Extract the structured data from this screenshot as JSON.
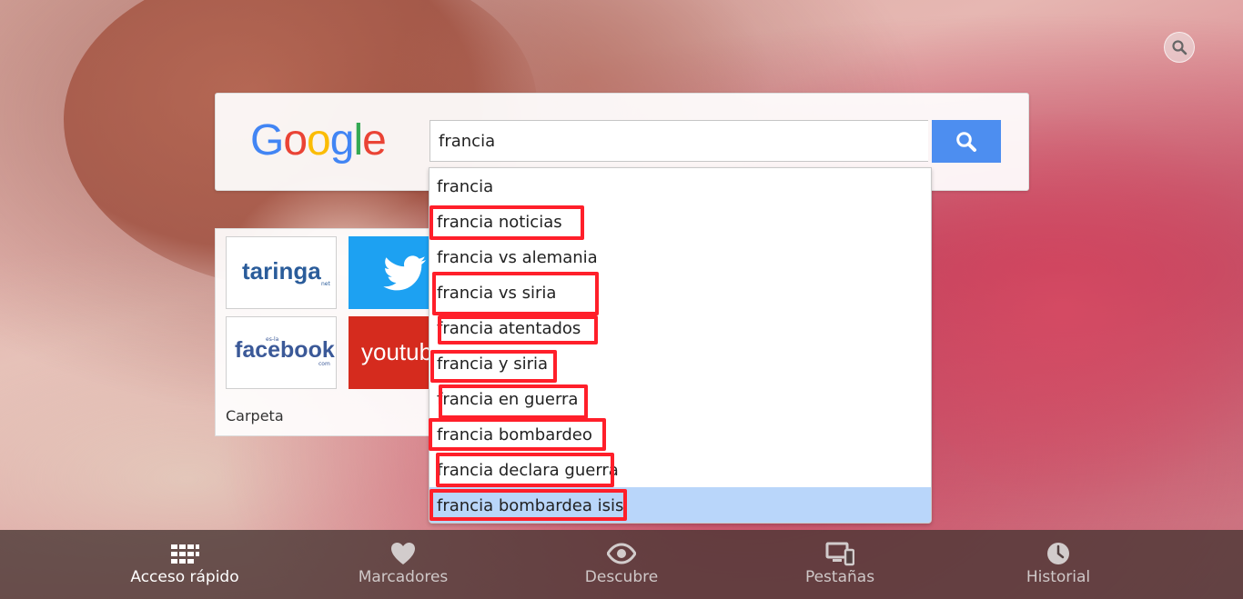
{
  "search": {
    "query": "francia",
    "logo_text": "Google"
  },
  "suggestions": [
    "francia",
    "francia noticias",
    "francia vs alemania",
    "francia vs siria",
    "francia atentados",
    "francia y siria",
    "francia en guerra",
    "francia bombardeo",
    "francia declara guerra",
    "francia bombardea isis"
  ],
  "selected_suggestion": "francia bombardea isis",
  "speed_dial": {
    "tiles": [
      {
        "name": "taringa",
        "label": "taringa",
        "sub": "net"
      },
      {
        "name": "twitter"
      },
      {
        "name": "facebook",
        "label": "facebook",
        "sub_top": "es-la",
        "sub": "com"
      },
      {
        "name": "youtube",
        "label": "youtube"
      }
    ],
    "folder_label": "Carpeta"
  },
  "bottom_nav": [
    {
      "label": "Acceso rápido",
      "icon": "grid-icon",
      "active": true
    },
    {
      "label": "Marcadores",
      "icon": "heart-icon",
      "active": false
    },
    {
      "label": "Descubre",
      "icon": "eye-icon",
      "active": false
    },
    {
      "label": "Pestañas",
      "icon": "devices-icon",
      "active": false
    },
    {
      "label": "Historial",
      "icon": "clock-icon",
      "active": false
    }
  ],
  "colors": {
    "search_button": "#4d8ef0",
    "highlight": "#ff1f2a",
    "selected_row": "#b9d6fa",
    "twitter": "#1da1f2",
    "youtube": "#d52b1e"
  }
}
